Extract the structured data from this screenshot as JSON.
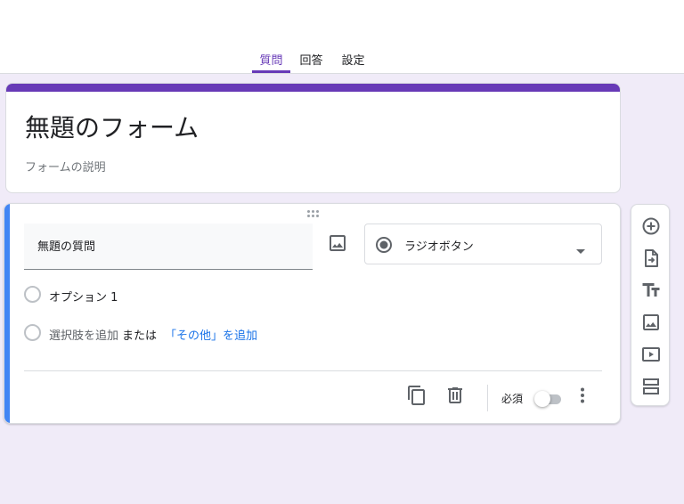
{
  "tabs": [
    {
      "label": "質問",
      "active": true
    },
    {
      "label": "回答",
      "active": false
    },
    {
      "label": "設定",
      "active": false
    }
  ],
  "form": {
    "title": "無題のフォーム",
    "description_placeholder": "フォームの説明",
    "accent_color": "#673ab7"
  },
  "question": {
    "title": "無題の質問",
    "type_label": "ラジオボタン",
    "options": [
      {
        "label": "オプション 1"
      }
    ],
    "add_option_label": "選択肢を追加",
    "or_label": "または",
    "add_other_label": "「その他」を追加",
    "required_label": "必須",
    "required_on": false
  },
  "footer_icons": [
    "copy-icon",
    "delete-icon",
    "more-vert-icon"
  ],
  "toolbar_icons": [
    "add-question-icon",
    "import-questions-icon",
    "add-title-icon",
    "add-image-icon",
    "add-video-icon",
    "add-section-icon"
  ],
  "colors": {
    "background": "#f0ebf8",
    "question_indicator": "#4285f4",
    "link": "#1a73e8"
  }
}
